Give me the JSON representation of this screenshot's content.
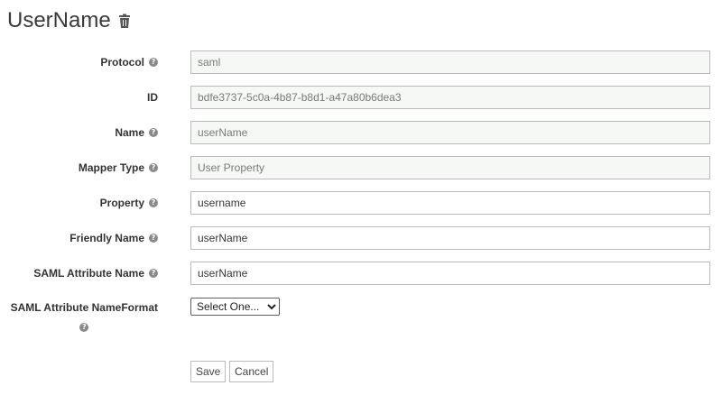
{
  "header": {
    "title": "UserName"
  },
  "form": {
    "protocol": {
      "label": "Protocol",
      "value": "saml"
    },
    "id": {
      "label": "ID",
      "value": "bdfe3737-5c0a-4b87-b8d1-a47a80b6dea3"
    },
    "name": {
      "label": "Name",
      "value": "userName"
    },
    "mapper_type": {
      "label": "Mapper Type",
      "value": "User Property"
    },
    "property": {
      "label": "Property",
      "value": "username"
    },
    "friendly_name": {
      "label": "Friendly Name",
      "value": "userName"
    },
    "saml_attribute_name": {
      "label": "SAML Attribute Name",
      "value": "userName"
    },
    "saml_attribute_nameformat": {
      "label": "SAML Attribute NameFormat",
      "selected": "Select One..."
    }
  },
  "actions": {
    "save": "Save",
    "cancel": "Cancel"
  },
  "icons": {
    "delete": "trash-icon",
    "help": "help-icon"
  }
}
